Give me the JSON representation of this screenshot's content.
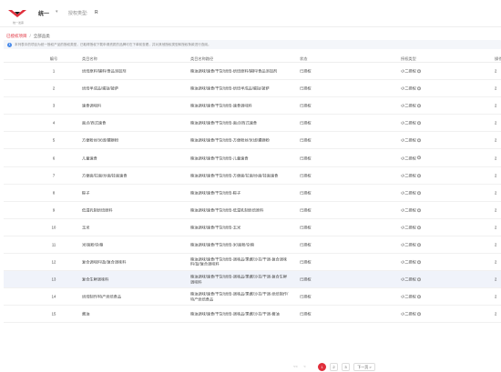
{
  "header": {
    "logo_caption": "统一发票",
    "brand": "统一",
    "brand_arrow": "▾",
    "ptype_label": "授权类型:",
    "ptype_value": "R"
  },
  "breadcrumb": {
    "parent": "已授权项目",
    "separator": "/",
    "current": "全部品类"
  },
  "notice": {
    "icon": "info-icon",
    "text": "本列表中的项目为统一授权产品的授权类型，已取得授权下载申请资质的品牌可在下单前查看，并对其他授权类型和授权条款进行查阅。"
  },
  "table": {
    "columns": [
      "编号",
      "类目名称",
      "类目名称路径",
      "状态",
      "授权类型",
      "操作"
    ],
    "rows": [
      {
        "num": "1",
        "name": "烘焙原料/辅料/食品添加剂",
        "path": "粮油调味/速食/干货/烘焙-烘焙原料/辅料/食品添加剂",
        "status": "已授权",
        "auth": "小二授权",
        "op": "2"
      },
      {
        "num": "2",
        "name": "烘焙半成品/蛋挞/披萨",
        "path": "粮油调味/速食/干货/烘焙-烘焙半成品/蛋挞/披萨",
        "status": "已授权",
        "auth": "小二授权",
        "op": "2"
      },
      {
        "num": "3",
        "name": "速食调味料",
        "path": "粮油调味/速食/干货/烘焙-速食调味料",
        "status": "已授权",
        "auth": "小二授权",
        "op": "2"
      },
      {
        "num": "4",
        "name": "面点/西式速食",
        "path": "粮油调味/速食/干货/烘焙-面点/西式速食",
        "status": "已授权",
        "auth": "小二授权",
        "op": "2"
      },
      {
        "num": "5",
        "name": "方便粉丝/米线/螺蛳粉",
        "path": "粮油调味/速食/干货/烘焙-方便粉丝/米线/螺蛳粉",
        "status": "已授权",
        "auth": "小二授权",
        "op": "2"
      },
      {
        "num": "6",
        "name": "儿童速食",
        "path": "粮油调味/速食/干货/烘焙-儿童速食",
        "status": "已授权",
        "auth": "小二授权",
        "op": "2"
      },
      {
        "num": "7",
        "name": "方便面/拉面/炒面/挂面速食",
        "path": "粮油调味/速食/干货/烘焙-方便面/拉面/炒面/挂面速食",
        "status": "已授权",
        "auth": "小二授权",
        "op": "2"
      },
      {
        "num": "8",
        "name": "粽子",
        "path": "粮油调味/速食/干货/烘焙-粽子",
        "status": "已授权",
        "auth": "小二授权",
        "op": "2"
      },
      {
        "num": "9",
        "name": "低温乳制烘焙原料",
        "path": "粮油调味/速食/干货/烘焙-低温乳制烘焙原料",
        "status": "已授权",
        "auth": "小二授权",
        "op": "2"
      },
      {
        "num": "10",
        "name": "玉米",
        "path": "粮油调味/速食/干货/烘焙-玉米",
        "status": "已授权",
        "auth": "小二授权",
        "op": "2"
      },
      {
        "num": "11",
        "name": "米/面粉/杂粮",
        "path": "粮油调味/速食/干货/烘焙-米/面粉/杂粮",
        "status": "已授权",
        "auth": "小二授权",
        "op": "2"
      },
      {
        "num": "12",
        "name": "复合调味料/盐/复合调味料",
        "path": "粮油调味/速食/干货/烘焙-调味品/果酱/沙拉/干调-复合调味料/盐/复合调味料",
        "status": "已授权",
        "auth": "小二授权",
        "op": "2"
      },
      {
        "num": "13",
        "name": "复合生鲜调味料",
        "path": "粮油调味/速食/干货/烘焙-调味品/果酱/沙拉/干调-复合生鲜调味料",
        "status": "已授权",
        "auth": "小二授权",
        "op": "2"
      },
      {
        "num": "14",
        "name": "烘焙制作/特产烘焙食品",
        "path": "粮油调味/速食/干货/烘焙-调味品/果酱/沙拉/干调-烘焙制作/特产烘焙食品",
        "status": "已授权",
        "auth": "小二授权",
        "op": "2"
      },
      {
        "num": "15",
        "name": "酱油",
        "path": "粮油调味/速食/干货/烘焙-调味品/果酱/沙拉/干调-酱油",
        "status": "已授权",
        "auth": "小二授权",
        "op": "2"
      }
    ]
  },
  "pager": {
    "first": "<<",
    "prev": "<",
    "pages": [
      "1",
      "2",
      "3"
    ],
    "next": "下一页 >"
  },
  "colors": {
    "accent": "#e02e3b",
    "highlight_row": "#f0f3fa",
    "info": "#4a8bea"
  }
}
